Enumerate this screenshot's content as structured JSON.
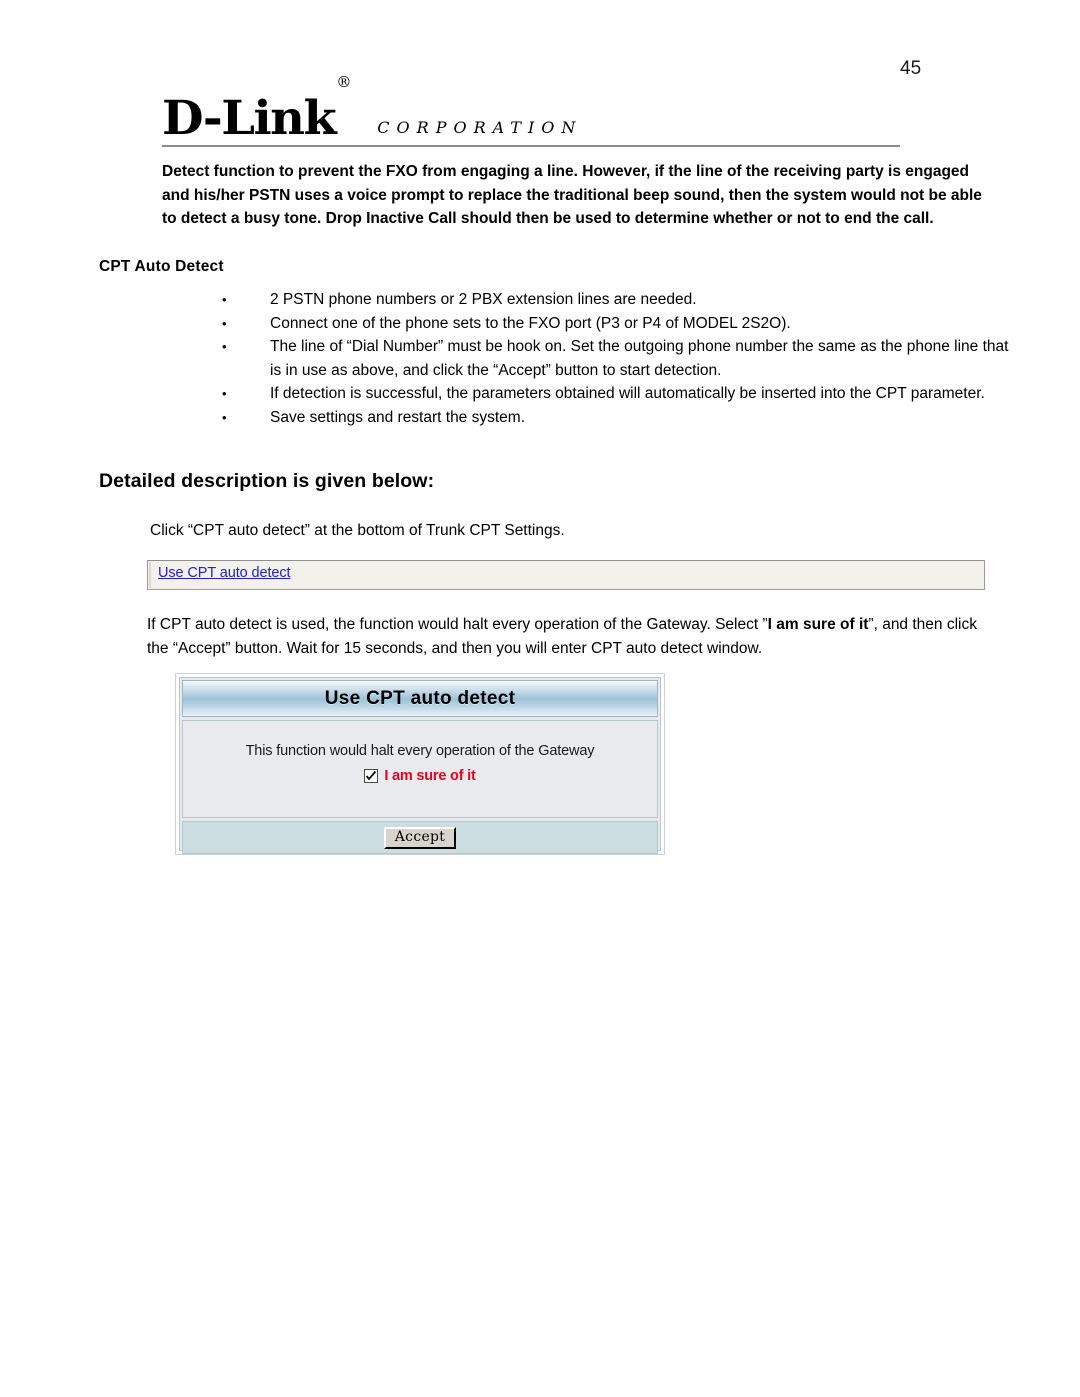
{
  "page": {
    "number": "45"
  },
  "header": {
    "logo_name": "D-Link",
    "logo_registered": "®",
    "logo_corporation": "CORPORATION"
  },
  "intro": {
    "paragraph": "Detect function to prevent the FXO from engaging a line. However, if the line of the receiving party is engaged and his/her PSTN uses a voice prompt to replace the traditional beep sound, then the system would not be able to detect a busy tone. Drop Inactive Call should then be used to determine whether or not to end the call."
  },
  "section_cpt_auto_detect": {
    "subheading": "CPT Auto Detect",
    "bullet_marker": "•",
    "bullets": [
      "2 PSTN phone numbers or 2 PBX extension lines are needed.",
      "Connect one of the phone sets to the FXO port (P3 or P4 of MODEL 2S2O).",
      "The line of “Dial Number” must be hook on. Set the outgoing phone number the same as the phone line that is in use as above, and click the “Accept” button to start detection.",
      "If detection is successful, the parameters obtained will automatically be inserted into the CPT parameter.",
      "Save settings and restart the system."
    ]
  },
  "detailed_description": {
    "heading": "Detailed description is given below:",
    "click_instruction": "Click “CPT auto detect” at the bottom of Trunk CPT Settings."
  },
  "link_box": {
    "link_label": "Use CPT auto detect"
  },
  "usage_paragraph": {
    "part1": "If CPT auto detect is used, the function would halt every operation of the Gateway. Select ”",
    "emphasis": "I am sure of it",
    "part2": "”, and then click the “Accept” button.   Wait for 15 seconds, and then you will enter CPT auto detect window."
  },
  "dialog": {
    "title": "Use CPT auto detect",
    "message": "This function would halt every operation of the Gateway",
    "confirm_label": "I am sure of it",
    "confirm_checked": true,
    "accept_button": "Accept",
    "colors": {
      "title_bar_blue": "#9fc2d8",
      "body_background": "#e8eaee",
      "footer_background": "#ccdde1",
      "confirm_text": "#e8001c",
      "link_blue": "#2222cc"
    }
  }
}
